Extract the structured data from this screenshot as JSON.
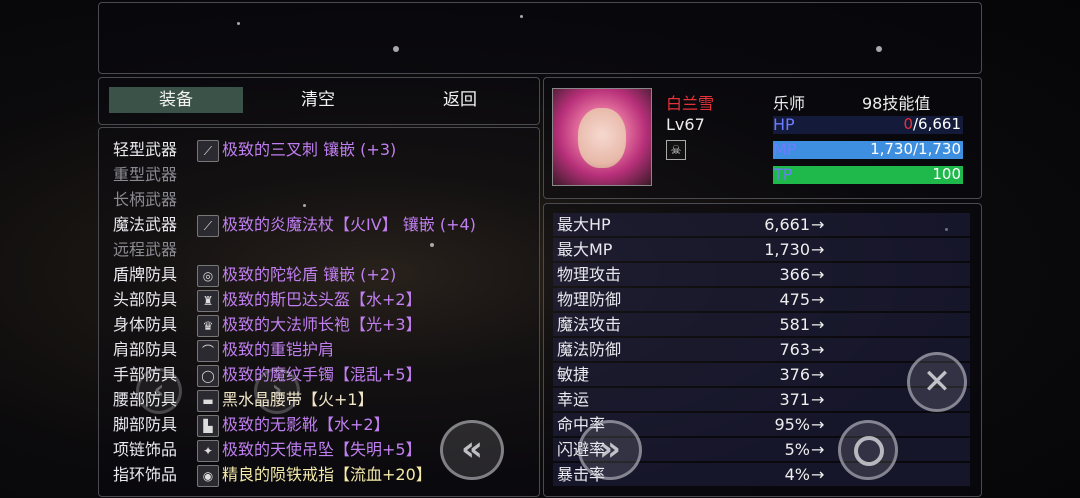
{
  "tabs": {
    "equip": "装备",
    "clear": "清空",
    "back": "返回"
  },
  "equipment": [
    {
      "slot": "轻型武器",
      "item": "极致的三叉刺 镶嵌 (+3)",
      "icon": "trident-icon",
      "glyph": "⟋",
      "style": "purple"
    },
    {
      "slot": "重型武器",
      "item": "",
      "icon": "",
      "glyph": "",
      "style": "empty"
    },
    {
      "slot": "长柄武器",
      "item": "",
      "icon": "",
      "glyph": "",
      "style": "empty"
    },
    {
      "slot": "魔法武器",
      "item": "极致的炎魔法杖【火IV】 镶嵌 (+4)",
      "icon": "staff-icon",
      "glyph": "⟋",
      "style": "purple"
    },
    {
      "slot": "远程武器",
      "item": "",
      "icon": "",
      "glyph": "",
      "style": "empty"
    },
    {
      "slot": "盾牌防具",
      "item": "极致的陀轮盾 镶嵌 (+2)",
      "icon": "shield-icon",
      "glyph": "◎",
      "style": "purple"
    },
    {
      "slot": "头部防具",
      "item": "极致的斯巴达头盔【水+2】",
      "icon": "helmet-icon",
      "glyph": "♜",
      "style": "purple"
    },
    {
      "slot": "身体防具",
      "item": "极致的大法师长袍【光+3】",
      "icon": "robe-icon",
      "glyph": "♛",
      "style": "purple"
    },
    {
      "slot": "肩部防具",
      "item": "极致的重铠护肩",
      "icon": "pauldron-icon",
      "glyph": "⌒",
      "style": "purple"
    },
    {
      "slot": "手部防具",
      "item": "极致的魔纹手镯【混乱+5】",
      "icon": "bracelet-icon",
      "glyph": "◯",
      "style": "purple"
    },
    {
      "slot": "腰部防具",
      "item": "黑水晶腰带【火+1】",
      "icon": "belt-icon",
      "glyph": "▬",
      "style": "normal"
    },
    {
      "slot": "脚部防具",
      "item": "极致的无影靴【水+2】",
      "icon": "boots-icon",
      "glyph": "▙",
      "style": "purple"
    },
    {
      "slot": "项链饰品",
      "item": "极致的天使吊坠【失明+5】",
      "icon": "pendant-icon",
      "glyph": "✦",
      "style": "purple"
    },
    {
      "slot": "指环饰品",
      "item": "精良的陨铁戒指【流血+20】",
      "icon": "ring-icon",
      "glyph": "◉",
      "style": "yellow"
    }
  ],
  "character": {
    "name": "白兰雪",
    "class": "乐师",
    "skill_points": "98技能值",
    "level_label": "Lv",
    "level": "67",
    "hp_label": "HP",
    "hp_current": "0",
    "hp_max": "/6,661",
    "hp_fraction": 0.0,
    "mp_label": "MP",
    "mp_value": "1,730/1,730",
    "mp_fraction": 1.0,
    "tp_label": "TP",
    "tp_value": "100",
    "tp_fraction": 1.0,
    "status_icon": "skull-icon"
  },
  "stats": [
    {
      "label": "最大HP",
      "value": "6,661"
    },
    {
      "label": "最大MP",
      "value": "1,730"
    },
    {
      "label": "物理攻击",
      "value": "366"
    },
    {
      "label": "物理防御",
      "value": "475"
    },
    {
      "label": "魔法攻击",
      "value": "581"
    },
    {
      "label": "魔法防御",
      "value": "763"
    },
    {
      "label": "敏捷",
      "value": "376"
    },
    {
      "label": "幸运",
      "value": "371"
    },
    {
      "label": "命中率",
      "value": "95%"
    },
    {
      "label": "闪避率",
      "value": "5%"
    },
    {
      "label": "暴击率",
      "value": "4%"
    }
  ],
  "arrow": "→",
  "controls": {
    "cancel": "✕",
    "pageup": "«",
    "pagedown": "»",
    "left": "‹",
    "right": "›"
  },
  "colors": {
    "name": "#e8323a",
    "rare_item": "#c07ff0",
    "mp_bar": "#3f8fe0",
    "tp_bar": "#1fb84a",
    "hp_bar": "#c0203a"
  }
}
